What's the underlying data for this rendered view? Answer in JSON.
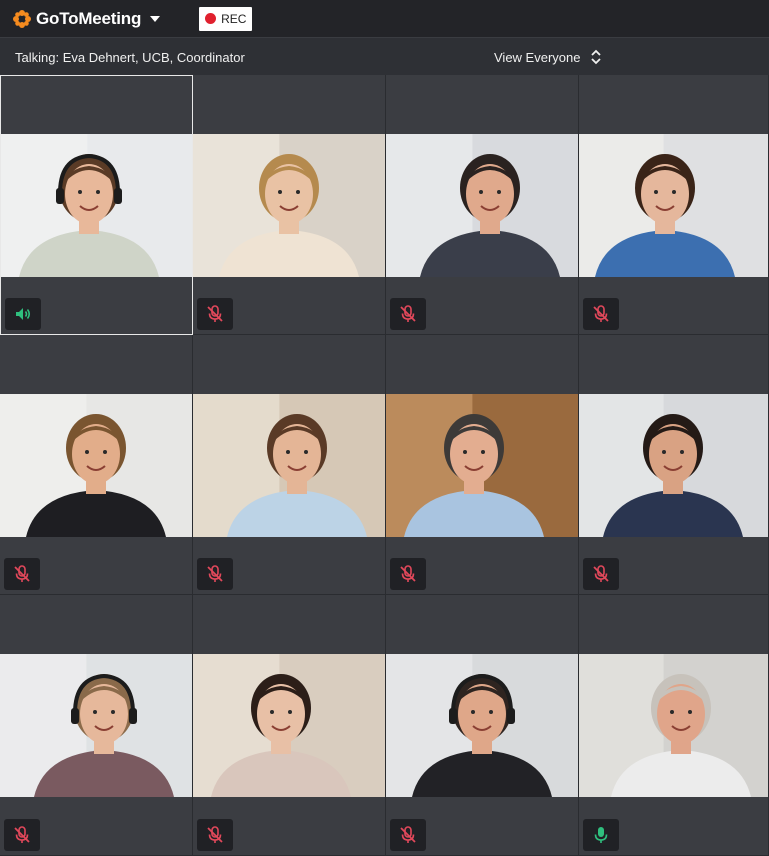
{
  "app": {
    "name": "GoToMeeting",
    "rec_label": "REC"
  },
  "status": {
    "talking_text": "Talking: Eva Dehnert, UCB, Coordinator",
    "view_label": "View Everyone"
  },
  "colors": {
    "accent_orange": "#f58b1f",
    "rec_red": "#e0202e",
    "muted_red": "#e2485b",
    "active_green": "#2fbf7e"
  },
  "tiles": [
    {
      "mic": "speaking",
      "bg": "#e8eaec",
      "wall": "#f2f2f2",
      "hair": "#5a3b26",
      "skin": "#e8b89a",
      "shirt": "#cfd4c8",
      "headset": true
    },
    {
      "mic": "muted",
      "bg": "#d9d2c8",
      "wall": "#efe9e0",
      "hair": "#b58a4e",
      "skin": "#e9c2a4",
      "shirt": "#efe3d3",
      "headset": false
    },
    {
      "mic": "muted",
      "bg": "#d8dade",
      "wall": "#eceef0",
      "hair": "#2a2220",
      "skin": "#e0a98c",
      "shirt": "#3a3e4a",
      "headset": false
    },
    {
      "mic": "muted",
      "bg": "#dfe0e2",
      "wall": "#f0efed",
      "hair": "#3a2418",
      "skin": "#e5b79c",
      "shirt": "#3c6fb0",
      "headset": false
    },
    {
      "mic": "muted",
      "bg": "#e7e7e5",
      "wall": "#f1f1ef",
      "hair": "#7a5530",
      "skin": "#e2ad8a",
      "shirt": "#1e1e22",
      "headset": false
    },
    {
      "mic": "muted",
      "bg": "#d6c8b6",
      "wall": "#e9e2d5",
      "hair": "#5a3a26",
      "skin": "#e4b596",
      "shirt": "#bcd3e6",
      "headset": false
    },
    {
      "mic": "muted",
      "bg": "#9a6a3e",
      "wall": "#c99a6a",
      "hair": "#3d3a38",
      "skin": "#e3ad90",
      "shirt": "#a9c4e0",
      "headset": false
    },
    {
      "mic": "muted",
      "bg": "#d7d9dc",
      "wall": "#e8e9ea",
      "hair": "#241a16",
      "skin": "#d9a283",
      "shirt": "#2a3550",
      "headset": false
    },
    {
      "mic": "muted",
      "bg": "#dfe2e4",
      "wall": "#eff0f1",
      "hair": "#8a6a4a",
      "skin": "#e6b89b",
      "shirt": "#7a5a60",
      "headset": true
    },
    {
      "mic": "muted",
      "bg": "#d9cdbf",
      "wall": "#ebe4d9",
      "hair": "#2c1e18",
      "skin": "#e8c0a6",
      "shirt": "#d9c6bc",
      "headset": false
    },
    {
      "mic": "muted",
      "bg": "#d8dadc",
      "wall": "#e9eaeb",
      "hair": "#2e2420",
      "skin": "#dfa789",
      "shirt": "#222226",
      "headset": true
    },
    {
      "mic": "active",
      "bg": "#d3d2cf",
      "wall": "#e6e4e0",
      "hair": "#c7c2bb",
      "skin": "#e0a58a",
      "shirt": "#ececec",
      "headset": false
    }
  ]
}
